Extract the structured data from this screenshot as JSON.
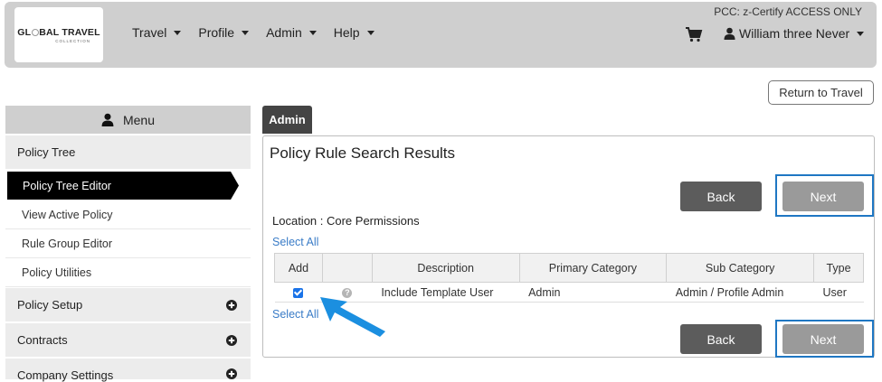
{
  "header": {
    "logo_text_1": "GL",
    "logo_text_2": "BAL TRAVEL",
    "logo_sub": "COLLECTION",
    "nav": [
      {
        "label": "Travel"
      },
      {
        "label": "Profile"
      },
      {
        "label": "Admin"
      },
      {
        "label": "Help"
      }
    ],
    "pcc": "PCC: z-Certify ACCESS ONLY",
    "user_name": "William three Never"
  },
  "return_button": "Return to Travel",
  "sidebar": {
    "title": "Menu",
    "groups": [
      {
        "label": "Policy Tree"
      },
      {
        "label": "Policy Setup"
      },
      {
        "label": "Contracts"
      },
      {
        "label": "Company Settings"
      }
    ],
    "items": [
      {
        "label": "Policy Tree Editor",
        "active": true
      },
      {
        "label": "View Active Policy"
      },
      {
        "label": "Rule Group Editor"
      },
      {
        "label": "Policy Utilities"
      }
    ]
  },
  "main": {
    "tab": "Admin",
    "title": "Policy Rule Search Results",
    "back_label": "Back",
    "next_label": "Next",
    "location": "Location : Core Permissions",
    "select_all": "Select All",
    "table": {
      "headers": [
        "Add",
        "",
        "Description",
        "Primary Category",
        "Sub Category",
        "Type"
      ],
      "rows": [
        {
          "checked": true,
          "description": "Include Template User",
          "primary": "Admin",
          "sub": "Admin / Profile Admin",
          "type": "User"
        }
      ]
    }
  },
  "colors": {
    "highlight": "#1f77c3",
    "arrow": "#1b8fe0",
    "header_bg": "#cfcfcf"
  }
}
